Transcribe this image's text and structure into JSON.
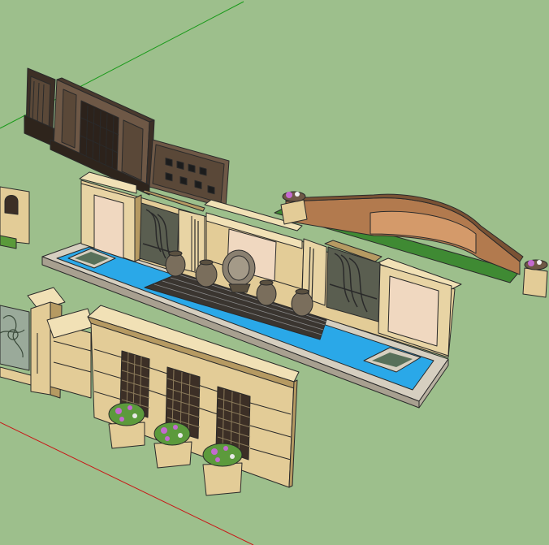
{
  "app": {
    "background_color": "#9dbf8c"
  },
  "axes": {
    "green_axis_color": "#1a9a1a",
    "red_axis_color": "#c81818"
  },
  "palette": {
    "stone": "#e3cc97",
    "stone_dark": "#b69a62",
    "stone_light": "#f1e1b6",
    "cream_panel": "#f0d8c0",
    "pool_water": "#2aa8e8",
    "pool_edge": "#d6cfc0",
    "dark_wood": "#3c2f26",
    "mid_wood": "#6e5846",
    "brick": "#b27a4e",
    "brick_light": "#d49a6a",
    "grass": "#3f8a33",
    "flowers": "#c46ad0",
    "leaves": "#5c9a3c"
  },
  "objects": [
    {
      "name": "wood-screen-panels"
    },
    {
      "name": "fountain-wall-with-pool"
    },
    {
      "name": "curved-brick-wall"
    },
    {
      "name": "lattice-wall-with-planters"
    },
    {
      "name": "fence-fragment-left"
    }
  ]
}
